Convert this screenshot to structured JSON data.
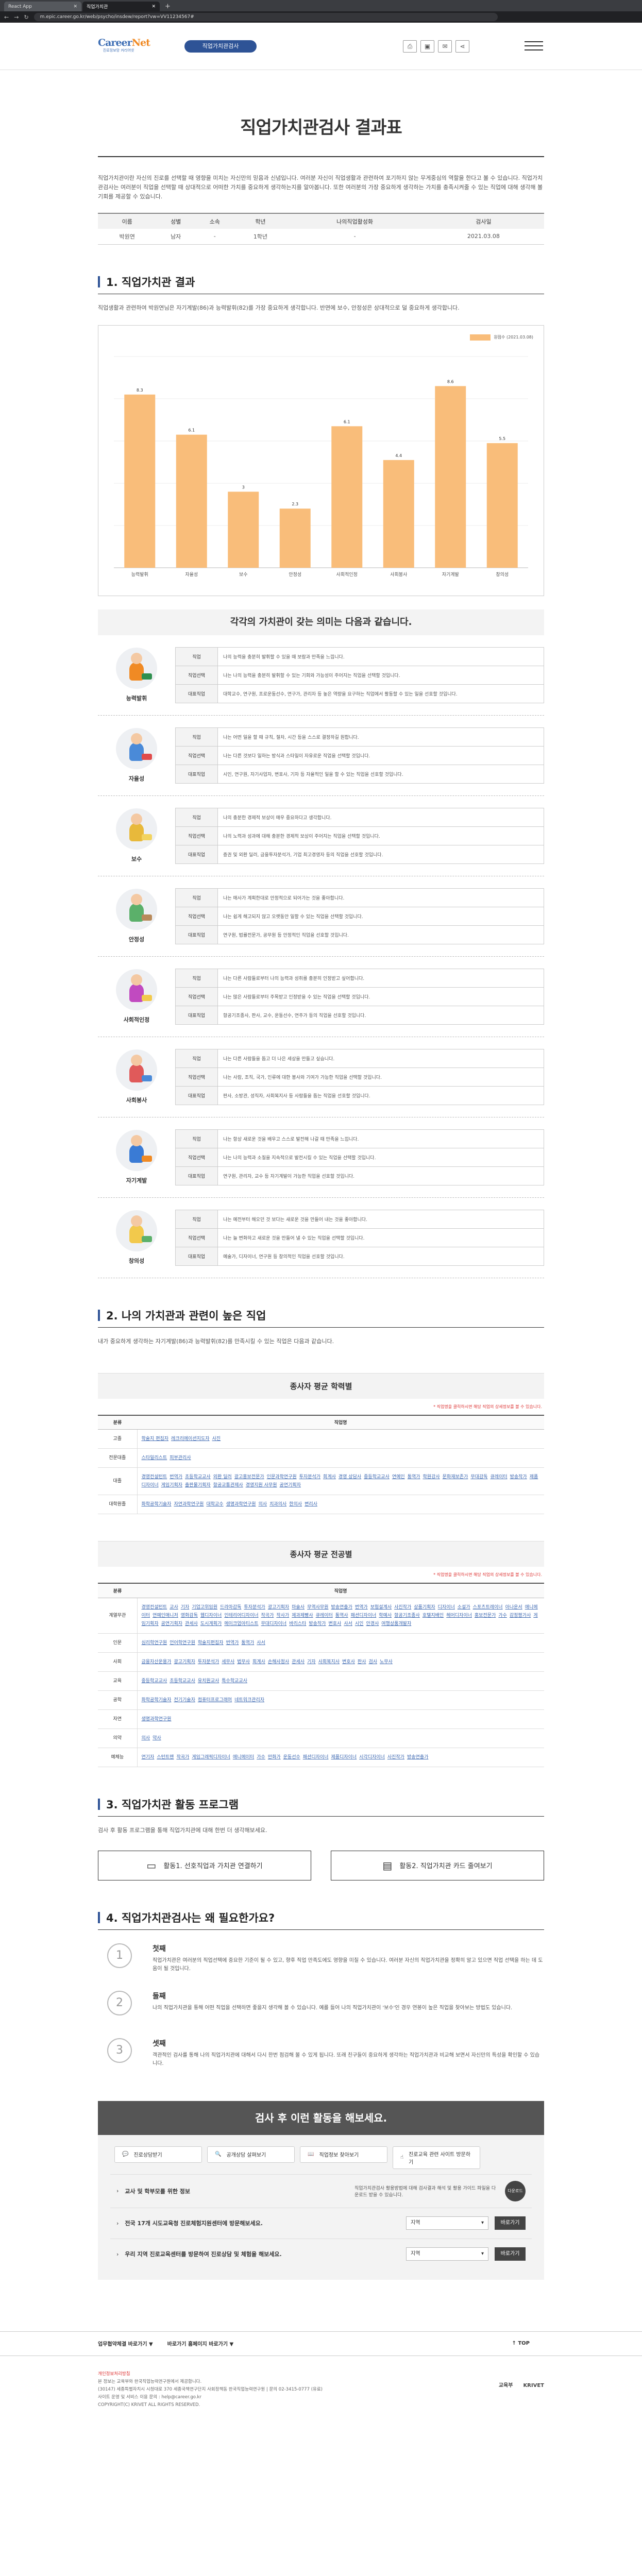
{
  "browser": {
    "tabs": [
      {
        "label": "React App",
        "active": false
      },
      {
        "label": "직업가치관",
        "active": true
      }
    ],
    "url": "m.epic.career.go.kr/web/psycho/insdew/report?vw=VV11234567#"
  },
  "header": {
    "logo_main": "Career",
    "logo_accent": "Net",
    "logo_sub": "진로정보망 커리어넷",
    "center_btn": "직업가치관검사"
  },
  "page": {
    "title": "직업가치관검사 결과표",
    "intro": "직업가치관이란 자신의 진로를 선택할 때 영향을 미치는 자신만의 믿음과 신념입니다. 여러분 자신이 직업생활과 관련하여 포기하지 않는 무게중심의 역할을 한다고 볼 수 있습니다. 직업가치관검사는 여러분이 직업을 선택할 때 상대적으로 어떠한 가치를 중요하게 생각하는지를 알아봅니다. 또한 여러분의 가장 중요하게 생각하는 가치를 충족시켜줄 수 있는 직업에 대해 생각해 볼 기회를 제공할 수 있습니다."
  },
  "info": {
    "headers": [
      "이름",
      "성별",
      "소속",
      "학년",
      "나의직업활성화",
      "검사일"
    ],
    "values": [
      "박원연",
      "남자",
      "-",
      "1학년",
      "-",
      "2021.03.08"
    ]
  },
  "sec1": {
    "title": "1. 직업가치관 결과",
    "desc": "직업생활과 관련하여 박원연님은 자기계발(86)과 능력발휘(82)를 가장 중요하게 생각합니다. 반면에 보수, 안정성은 상대적으로 덜 중요하게 생각합니다.",
    "legend": "원점수 (2021.03.08)"
  },
  "chart_data": {
    "type": "bar",
    "categories": [
      "능력발휘",
      "자율성",
      "보수",
      "안정성",
      "사회적인정",
      "사회봉사",
      "자기계발",
      "창의성"
    ],
    "values": [
      82,
      63,
      36,
      28,
      67,
      51,
      86,
      59
    ],
    "value_labels": [
      "8.3",
      "6.1",
      "3",
      "2.3",
      "6.1",
      "4.4",
      "8.6",
      "5.5"
    ],
    "ylim": [
      0,
      100
    ],
    "color": "#f9bd7a"
  },
  "meaning_title": "각각의 가치관이 갖는 의미는 다음과 같습니다.",
  "values": [
    {
      "name": "능력발휘",
      "body_color": "#f08a24",
      "prop_color": "#2f8f4e",
      "rows": [
        [
          "직업",
          "나의 능력을 충분히 발휘할 수 있을 때 보람과 만족을 느낍니다."
        ],
        [
          "직업선택",
          "나는 나의 능력을 충분히 발휘할 수 있는 기회와 가능성이 주어지는 직업을 선택할 것입니다."
        ],
        [
          "대표직업",
          "대학교수, 연구원, 프로운동선수, 연구가, 관리자 등 높은 역량을 요구하는 직업에서 활동할 수 있는 일을 선호할 것입니다."
        ]
      ]
    },
    {
      "name": "자율성",
      "body_color": "#4a8ad8",
      "prop_color": "#e04b4b",
      "rows": [
        [
          "직업",
          "나는 어떤 일을 할 때 규칙, 절차, 시간 등을 스스로 결정하길 원합니다."
        ],
        [
          "직업선택",
          "나는 다른 것보다 일하는 방식과 스타일이 자유로운 직업을 선택할 것입니다."
        ],
        [
          "대표직업",
          "시인, 연구원, 자기사업자, 변호사, 기자 등 자율적인 일을 할 수 있는 직업을 선호할 것입니다."
        ]
      ]
    },
    {
      "name": "보수",
      "body_color": "#e8b93b",
      "prop_color": "#f2d35f",
      "rows": [
        [
          "직업",
          "나의 충분한 경제적 보상이 매우 중요하다고 생각합니다."
        ],
        [
          "직업선택",
          "나의 노력과 성과에 대해 충분한 경제적 보상이 주어지는 직업을 선택할 것입니다."
        ],
        [
          "대표직업",
          "증권 및 외환 딜러, 금융투자분석가, 기업 최고경영자 등의 직업을 선호할 것입니다."
        ]
      ]
    },
    {
      "name": "안정성",
      "body_color": "#5bb06a",
      "prop_color": "#b88a5a",
      "rows": [
        [
          "직업",
          "나는 매사가 계획한대로 안정적으로 되어가는 것을 좋아합니다."
        ],
        [
          "직업선택",
          "나는 쉽게 해고되지 않고 오랫동안 일할 수 있는 직업을 선택할 것입니다."
        ],
        [
          "대표직업",
          "연구원, 법률전문가, 공무원 등 안정적인 직업을 선호할 것입니다."
        ]
      ]
    },
    {
      "name": "사회적인정",
      "body_color": "#c14ac0",
      "prop_color": "#f2c94c",
      "rows": [
        [
          "직업",
          "나는 다른 사람들로부터 나의 능력과 성취를 충분히 인정받고 싶어합니다."
        ],
        [
          "직업선택",
          "나는 많은 사람들로부터 주목받고 인정받을 수 있는 직업을 선택할 것입니다."
        ],
        [
          "대표직업",
          "항공기조종사, 판사, 교수, 운동선수, 연주가 등의 직업을 선호할 것입니다."
        ]
      ]
    },
    {
      "name": "사회봉사",
      "body_color": "#e05a5a",
      "prop_color": "#4a8ad8",
      "rows": [
        [
          "직업",
          "나는 다른 사람들을 돕고 더 나은 세상을 만들고 싶습니다."
        ],
        [
          "직업선택",
          "나는 사람, 조직, 국가, 인류에 대한 봉사와 기여가 가능한 직업을 선택할 것입니다."
        ],
        [
          "대표직업",
          "판사, 소방관, 성직자, 사회복지사 등 사람들을 돕는 직업을 선호할 것입니다."
        ]
      ]
    },
    {
      "name": "자기계발",
      "body_color": "#3a7bd5",
      "prop_color": "#f08a24",
      "rows": [
        [
          "직업",
          "나는 항상 새로운 것을 배우고 스스로 발전해 나갈 때 만족을 느낍니다."
        ],
        [
          "직업선택",
          "나는 나의 능력과 소질을 지속적으로 발전시킬 수 있는 직업을 선택할 것입니다."
        ],
        [
          "대표직업",
          "연구원, 관리자, 교수 등 자기계발이 가능한 직업을 선호할 것입니다."
        ]
      ]
    },
    {
      "name": "창의성",
      "body_color": "#f2c94c",
      "prop_color": "#5bb06a",
      "rows": [
        [
          "직업",
          "나는 예전부터 해오던 것 보다는 새로운 것을 만들어 내는 것을 좋아합니다."
        ],
        [
          "직업선택",
          "나는 늘 변화하고 새로운 것을 만들어 낼 수 있는 직업을 선택할 것입니다."
        ],
        [
          "대표직업",
          "예술가, 디자이너, 연구원 등 창의적인 직업을 선호할 것입니다."
        ]
      ]
    }
  ],
  "sec2": {
    "title": "2. 나의 가치관과 관련이 높은 직업",
    "desc": "내가 중요하게 생각하는 자기계발(86)과 능력발휘(82)를 만족시킬 수 있는 직업은 다음과 같습니다.",
    "edu_title": "종사자 평균 학력별",
    "edu_note": "* 직업명을 클릭하시면 해당 직업의 상세정보를 볼 수 있습니다.",
    "th": [
      "분류",
      "직업명"
    ],
    "edu_rows": [
      {
        "k": "고졸",
        "jobs": [
          "학술지 편집자",
          "레크리에이션지도자",
          "사진"
        ]
      },
      {
        "k": "전문대졸",
        "jobs": [
          "스타일리스트",
          "피부관리사"
        ]
      },
      {
        "k": "대졸",
        "jobs": [
          "경영컨설턴트",
          "번역가",
          "초등학교교사",
          "외환 딜러",
          "광고홍보전문가",
          "인문과학연구원",
          "투자분석가",
          "회계사",
          "경영 상담사",
          "중등학교교사",
          "연예인",
          "통역가",
          "학원강사",
          "문화재보존가",
          "무대감독",
          "큐레이터",
          "방송작가",
          "제품디자이너",
          "게임기획자",
          "출판물기획자",
          "항공교통관제사",
          "경영지원 사무원",
          "공연기획자"
        ]
      },
      {
        "k": "대학원졸",
        "jobs": [
          "화학공학기술자",
          "자연과학연구원",
          "대학교수",
          "생명과학연구원",
          "의사",
          "치과의사",
          "한의사",
          "변리사"
        ]
      }
    ],
    "major_title": "종사자 평균 전공별",
    "major_rows": [
      {
        "k": "계열무관",
        "jobs": [
          "경영컨설턴트",
          "교사",
          "기자",
          "기업고위임원",
          "드라마감독",
          "투자분석가",
          "광고기획자",
          "마술사",
          "무역사무원",
          "방송연출가",
          "번역가",
          "보험설계사",
          "사진작가",
          "상품기획자",
          "디자이너",
          "소설가",
          "스포츠트레이너",
          "아나운서",
          "애니메이터",
          "연예인매니저",
          "영화감독",
          "웹디자이너",
          "인테리어디자이너",
          "작곡가",
          "작사가",
          "제과제빵사",
          "큐레이터",
          "통역사",
          "패션디자이너",
          "학예사",
          "항공기조종사",
          "호텔지배인",
          "헤어디자이너",
          "홍보전문가",
          "가수",
          "감정평가사",
          "게임기획자",
          "공연기획자",
          "관세사",
          "도시계획가",
          "메이크업아티스트",
          "무대디자이너",
          "바리스타",
          "방송작가",
          "변호사",
          "사서",
          "시인",
          "안경사",
          "여행상품개발자"
        ]
      },
      {
        "k": "인문",
        "jobs": [
          "심리학연구원",
          "언어학연구원",
          "학술지편집자",
          "번역가",
          "통역가",
          "사서"
        ]
      },
      {
        "k": "사회",
        "jobs": [
          "금융자산운용가",
          "광고기획자",
          "투자분석가",
          "세무사",
          "법무사",
          "회계사",
          "손해사정사",
          "관세사",
          "기자",
          "사회복지사",
          "변호사",
          "판사",
          "검사",
          "노무사"
        ]
      },
      {
        "k": "교육",
        "jobs": [
          "중등학교교사",
          "초등학교교사",
          "유치원교사",
          "특수학교교사"
        ]
      },
      {
        "k": "공학",
        "jobs": [
          "화학공학기술자",
          "전기기술자",
          "컴퓨터프로그래머",
          "네트워크관리자"
        ]
      },
      {
        "k": "자연",
        "jobs": [
          "생명과학연구원"
        ]
      },
      {
        "k": "의약",
        "jobs": [
          "의사",
          "약사"
        ]
      },
      {
        "k": "예체능",
        "jobs": [
          "연기자",
          "스턴트맨",
          "작곡가",
          "게임그래픽디자이너",
          "애니메이터",
          "가수",
          "만화가",
          "운동선수",
          "패션디자이너",
          "제품디자이너",
          "시각디자이너",
          "사진작가",
          "방송연출가"
        ]
      }
    ]
  },
  "sec3": {
    "title": "3. 직업가치관 활동 프로그램",
    "desc": "검사 후 활동 프로그램을 통해 직업가치관에 대해 한번 더 생각해보세요.",
    "btn1": "활동1. 선호직업과 가치관 연결하기",
    "btn2": "활동2. 직업가치관 카드 줄여보기"
  },
  "sec4": {
    "title": "4. 직업가치관검사는 왜 필요한가요?",
    "items": [
      {
        "num": "1",
        "h": "첫째",
        "t": "직업가치관은 여러분의 직업선택에 중요한 기준이 될 수 있고, 향후 직업 만족도에도 영향을 미칠 수 있습니다. 여러분 자신의 직업가치관을 정확히 알고 있으면 직업 선택을 하는 데 도움이 될 것입니다."
      },
      {
        "num": "2",
        "h": "둘째",
        "t": "나의 직업가치관을 통해 어떤 직업을 선택하면 좋을지 생각해 볼 수 있습니다. 예를 들어 나의 직업가치관이 '보수'인 경우 연봉이 높은 직업을 찾아보는 방법도 있습니다."
      },
      {
        "num": "3",
        "h": "셋째",
        "t": "객관적인 검사를 통해 나의 직업가치관에 대해서 다시 한번 점검해 볼 수 있게 됩니다. 또래 친구들이 중요하게 생각하는 직업가치관과 비교해 보면서 자신만의 특성을 확인할 수 있습니다."
      }
    ]
  },
  "after": {
    "title": "검사 후 이런 활동을 해보세요.",
    "btns": [
      "진로상담받기",
      "공개상담 살펴보기",
      "직업정보 찾아보기",
      "진로교육 관련 사이트 방문하기"
    ],
    "row1": {
      "label": "교사 및 학부모를 위한 정보",
      "mid": "직업가치관검사 활용방법에 대해 검사결과 해석 및 활용 가이드 파일을 다운로드 받을 수 있습니다.",
      "btn": "다운로드"
    },
    "row2": {
      "label": "전국 17개 시도교육청 진로체험지원센터에 방문해보세요.",
      "select": "지역",
      "btn": "바로가기"
    },
    "row3": {
      "label": "우리 지역 진로교육센터를 방문하여 진로상담 및 체험을 해보세요.",
      "select": "지역",
      "btn": "바로가기"
    }
  },
  "footer": {
    "nav": [
      "업무협약체결 바로가기 ▼",
      "바로가기 홈페이지 바로가기 ▼"
    ],
    "top": "↑ TOP",
    "policy": "개인정보처리방침",
    "lines": [
      "본 정보는 교육부와 한국직업능력연구원에서 제공합니다.",
      "(30147) 세종특별자치시 시청대로 370 세종국책연구단지 사회정책동 한국직업능력연구원 | 문의 02-3415-0777 (유료)",
      "사이트 운영 및 서비스 이용 문의 : help@career.go.kr",
      "COPYRIGHT(C) KRIVET ALL RIGHTS RESERVED."
    ],
    "logos": [
      "교육부",
      "KRIVET"
    ]
  }
}
